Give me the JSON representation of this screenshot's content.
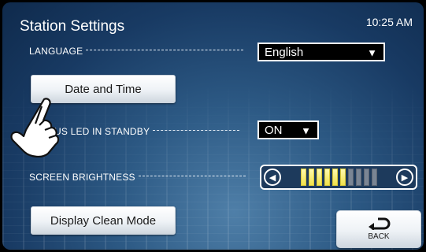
{
  "header": {
    "title": "Station Settings",
    "clock": "10:25 AM"
  },
  "language": {
    "label": "LANGUAGE",
    "value": "English",
    "arrow_icon": "triangle-down-icon"
  },
  "date_time": {
    "label": "Date and Time"
  },
  "status_led": {
    "label_visible": "US LED IN STANDBY",
    "value": "ON",
    "arrow_icon": "triangle-down-icon"
  },
  "screen_brightness": {
    "label": "SCREEN BRIGHTNESS",
    "level": 6,
    "max": 10
  },
  "display_clean": {
    "label": "Display Clean Mode"
  },
  "back": {
    "label": "BACK",
    "icon": "return-arrow-icon"
  },
  "colors": {
    "accent_segment": "#f0e14a",
    "background": "#1f4670"
  }
}
